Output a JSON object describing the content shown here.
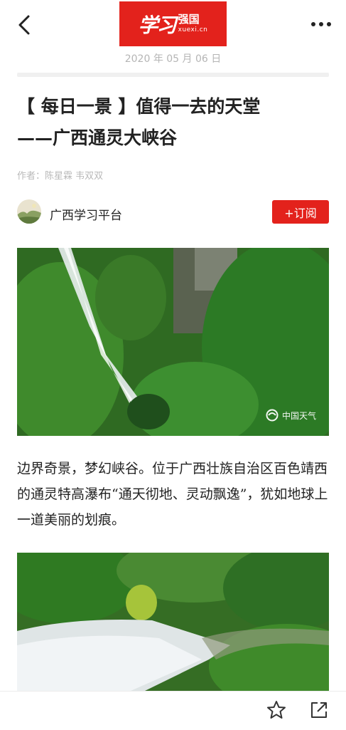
{
  "header": {
    "logo_calligraphy": "学习",
    "logo_name": "强国",
    "logo_site": "xuexi.cn",
    "date": "2020 年 05 月 06 日"
  },
  "article": {
    "title_line1": "【 每日一景 】值得一去的天堂",
    "title_line2": "——广西通灵大峡谷",
    "author": "作者：陈星霖 韦双双",
    "source_name": "广西学习平台",
    "subscribe_label": "+订阅",
    "image1_watermark": "中国天气",
    "paragraph": "边界奇景，梦幻峡谷。位于广西壮族自治区百色靖西的通灵特高瀑布“通天彻地、灵动飘逸”，犹如地球上一道美丽的划痕。"
  },
  "icons": {
    "back": "back-arrow-icon",
    "more": "more-dots-icon",
    "star": "star-icon",
    "share": "share-icon"
  },
  "colors": {
    "brand_red": "#e3221c",
    "muted_text": "#b5b5b5",
    "body_text": "#222222"
  }
}
